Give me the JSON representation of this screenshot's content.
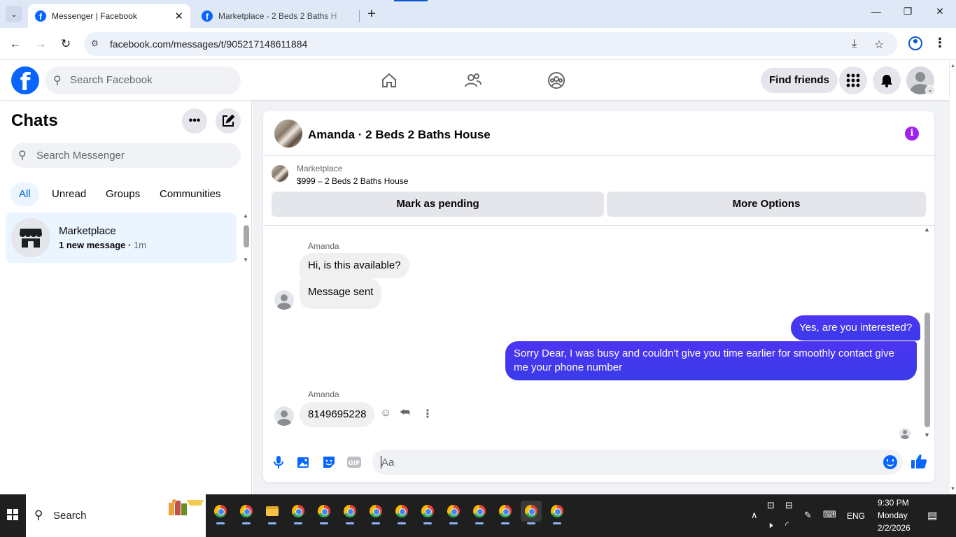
{
  "browser": {
    "tabs": [
      {
        "title": "Messenger | Facebook",
        "active": true
      },
      {
        "title": "Marketplace - 2 Beds 2 Baths H",
        "active": false
      }
    ],
    "url": "facebook.com/messages/t/905217148611884"
  },
  "fb_header": {
    "search_placeholder": "Search Facebook",
    "find_friends": "Find friends",
    "nav_icons": [
      "home-icon",
      "friends-icon",
      "groups-icon"
    ]
  },
  "chats": {
    "title": "Chats",
    "search_placeholder": "Search Messenger",
    "filters": [
      "All",
      "Unread",
      "Groups",
      "Communities"
    ],
    "active_filter": "All",
    "items": [
      {
        "name": "Marketplace",
        "preview": "1 new message",
        "time": "1m"
      }
    ]
  },
  "conversation": {
    "title": "Amanda · 2 Beds 2 Baths House",
    "marketplace_label": "Marketplace",
    "listing": "$999 – 2 Beds 2 Baths House",
    "mark_pending": "Mark as pending",
    "more_options": "More Options",
    "messages": [
      {
        "sender": "Amanda",
        "text": "Hi, is this available?",
        "direction": "in"
      },
      {
        "sender": "",
        "text": "Message sent",
        "direction": "in"
      },
      {
        "sender": "",
        "text": "Yes, are you interested?",
        "direction": "out"
      },
      {
        "sender": "",
        "text": "Sorry Dear, I was busy and couldn't give you time earlier for smoothly contact give me your phone number",
        "direction": "out"
      },
      {
        "sender": "Amanda",
        "text": "8149695228",
        "direction": "in"
      }
    ],
    "composer_placeholder": "Aa"
  },
  "taskbar": {
    "search_label": "Search",
    "time": "9:30 PM",
    "day": "Monday",
    "date": "2/2/2026",
    "lang": "ENG"
  },
  "colors": {
    "fb_blue": "#0866ff",
    "outgoing_bubble": "#4534f0",
    "info_purple": "#a020f0"
  }
}
